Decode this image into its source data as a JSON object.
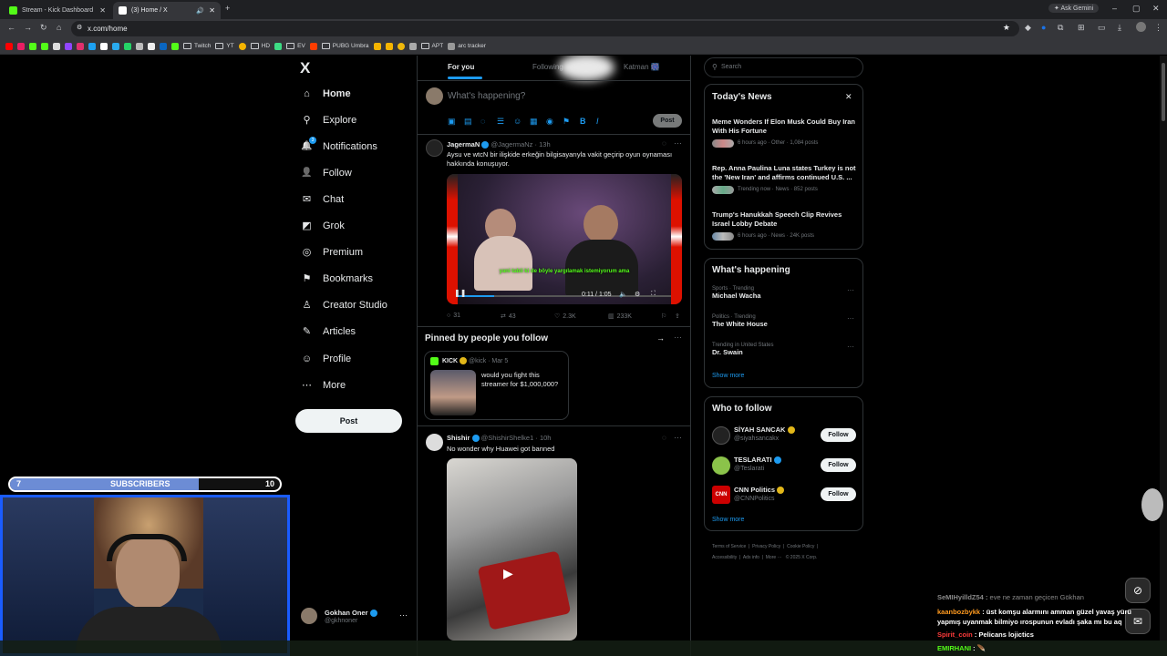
{
  "browser": {
    "tabs": [
      {
        "title": "Stream - Kick Dashboard",
        "fav_color": "#53fc18"
      },
      {
        "title": "(3) Home / X",
        "fav_color": "#ffffff"
      }
    ],
    "url": "x.com/home",
    "ask_gemini": "Ask Gemini",
    "bookmarks": [
      {
        "label": "Twitch",
        "type": "folder"
      },
      {
        "label": "YT",
        "type": "folder"
      },
      {
        "label": "HD",
        "type": "folder"
      },
      {
        "label": "EV",
        "type": "folder"
      },
      {
        "label": "PUBG Umbra",
        "type": "folder"
      },
      {
        "label": "APT",
        "type": "folder"
      },
      {
        "label": "arc tracker",
        "type": "link"
      }
    ]
  },
  "sidebar": {
    "logo": "X",
    "items": [
      {
        "label": "Home",
        "icon": "home-icon",
        "glyph": "⌂"
      },
      {
        "label": "Explore",
        "icon": "search-icon",
        "glyph": "⚲"
      },
      {
        "label": "Notifications",
        "icon": "bell-icon",
        "glyph": "🔔"
      },
      {
        "label": "Follow",
        "icon": "person-plus-icon",
        "glyph": "👤"
      },
      {
        "label": "Chat",
        "icon": "mail-icon",
        "glyph": "✉"
      },
      {
        "label": "Grok",
        "icon": "grok-icon",
        "glyph": "◩"
      },
      {
        "label": "Premium",
        "icon": "premium-icon",
        "glyph": "◎"
      },
      {
        "label": "Bookmarks",
        "icon": "bookmark-icon",
        "glyph": "⚑"
      },
      {
        "label": "Creator Studio",
        "icon": "creator-icon",
        "glyph": "♙"
      },
      {
        "label": "Articles",
        "icon": "articles-icon",
        "glyph": "✎"
      },
      {
        "label": "Profile",
        "icon": "profile-icon",
        "glyph": "☺"
      },
      {
        "label": "More",
        "icon": "more-icon",
        "glyph": "⋯"
      }
    ],
    "notif_count": "3",
    "post_label": "Post",
    "account": {
      "name": "Gokhan Oner",
      "handle": "@gkhnoner"
    }
  },
  "feed": {
    "tabs": [
      {
        "label": "For you"
      },
      {
        "label": "Following"
      },
      {
        "label": "Katman 🎆"
      }
    ],
    "compose_placeholder": "What's happening?",
    "compose_post": "Post",
    "tweet1": {
      "name": "JagermaN",
      "handle": "@JagermaNz",
      "time": "· 13h",
      "text": "Aysu ve wtcN bir ilişkide erkeğin bilgisayarıyla vakit geçirip oyun oynaması hakkında konuşuyor.",
      "caption": "yani tabii ki de böyle yargılamak istemiyorum ama",
      "time_display": "0:11 / 1:05",
      "progress": 0.17,
      "replies": "31",
      "reposts": "43",
      "likes": "2.3K",
      "views": "233K"
    },
    "pinned": {
      "title": "Pinned by people you follow",
      "name": "KICK",
      "handle": "@kick",
      "time": "· Mar 5",
      "text": "would you fight this streamer for $1,000,000?"
    },
    "tweet2": {
      "name": "Shishir",
      "handle": "@ShishirShelke1",
      "time": "· 10h",
      "text": "No wonder why Huawei got banned"
    }
  },
  "right": {
    "search_placeholder": "Search",
    "news_title": "Today's News",
    "news": [
      {
        "title": "Meme Wonders If Elon Musk Could Buy Iran With His Fortune",
        "meta": "6 hours ago · Other · 1,084 posts"
      },
      {
        "title": "Rep. Anna Paulina Luna states Turkey is not the 'New Iran' and affirms continued U.S. ...",
        "meta": "Trending now · News · 852 posts"
      },
      {
        "title": "Trump's Hanukkah Speech Clip Revives Israel Lobby Debate",
        "meta": "6 hours ago · News · 24K posts"
      }
    ],
    "happening_title": "What's happening",
    "trends": [
      {
        "context": "Sports · Trending",
        "title": "Michael Wacha"
      },
      {
        "context": "Politics · Trending",
        "title": "The White House"
      },
      {
        "context": "Trending in United States",
        "title": "Dr. Swain"
      }
    ],
    "show_more": "Show more",
    "who_title": "Who to follow",
    "follow": [
      {
        "name": "SİYAH SANCAK",
        "handle": "@siyahsancakx",
        "badge_color": "#e2b719",
        "avatar_color": "#222222"
      },
      {
        "name": "TESLARATI",
        "handle": "@Teslarati",
        "badge_color": "#1d9bf0",
        "avatar_color": "#8bc34a"
      },
      {
        "name": "CNN Politics",
        "handle": "@CNNPolitics",
        "badge_color": "#e2b719",
        "avatar_color": "#cc0000"
      }
    ],
    "follow_label": "Follow",
    "footer": [
      "Terms of Service",
      "Privacy Policy",
      "Cookie Policy",
      "Accessibility",
      "Ads info",
      "More ···",
      "© 2025 X Corp."
    ]
  },
  "overlay": {
    "sub_left": "7",
    "sub_label": "SUBSCRIBERS",
    "sub_right": "10",
    "sub_progress": 0.7,
    "chat": [
      {
        "user": "SeMIHyilldZ54",
        "text": "eve ne zaman geçicen Gökhan",
        "color": "#8a8a8a"
      },
      {
        "user": "kaanbozbykk",
        "text": "üst komşu alarmını amman güzel yavaş yürü yapmış uyanmak bilmiyo ırospunun evladı şaka mı bu aq",
        "color": "#ff9a1f"
      },
      {
        "user": "Spirit_coin",
        "text": "Pelicans lojictics",
        "color": "#ff3b3b"
      },
      {
        "user": "EMIRHANI",
        "text": "🪶",
        "color": "#53fc18"
      }
    ]
  }
}
